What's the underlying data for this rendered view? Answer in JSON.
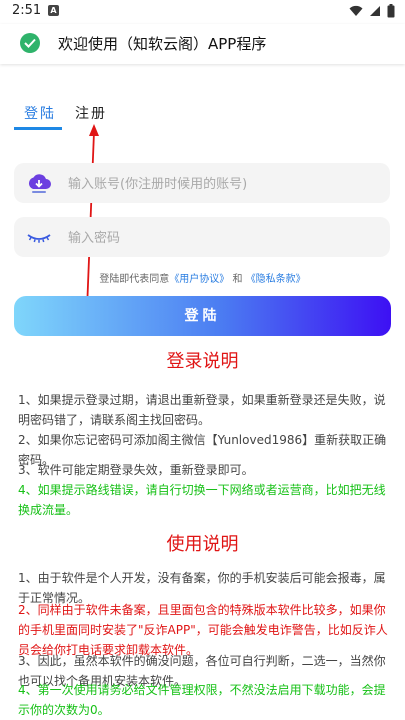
{
  "status_bar": {
    "time": "2:51",
    "notif_icon": "A"
  },
  "banner": {
    "title": "欢迎使用（知软云阁）APP程序",
    "icon": "check-circle-icon"
  },
  "tabs": [
    {
      "label": "登陆"
    },
    {
      "label": "注册"
    }
  ],
  "form": {
    "account_placeholder": "输入账号(你注册时候用的账号)",
    "password_placeholder": "输入密码",
    "agree_prefix": "登陆即代表同意",
    "user_agreement": "《用户协议》",
    "agree_and": "和",
    "privacy_policy": "《隐私条款》",
    "login_button": "登陆"
  },
  "login_notes": {
    "title": "登录说明",
    "items": [
      "1、如果提示登录过期，请退出重新登录，如果重新登录还是失败，说明密码错了，请联系阁主找回密码。",
      "2、如果你忘记密码可添加阁主微信【Yunloved1986】重新获取正确密码。",
      "3、软件可能定期登录失效，重新登录即可。",
      "4、如果提示路线错误，请自行切换一下网络或者运营商，比如把无线换成流量。"
    ]
  },
  "usage_notes": {
    "title": "使用说明",
    "items": [
      "1、由于软件是个人开发，没有备案，你的手机安装后可能会报毒，属于正常情况。",
      "2、同样由于软件未备案，且里面包含的特殊版本软件比较多，如果你的手机里面同时安装了\"反诈APP\"，可能会触发电诈警告，比如反诈人员会给你打电话要求卸载本软件。",
      "3、因此，虽然本软件的确没问题，各位可自行判断，二选一，当然你也可以找个备用机安装本软件。",
      "4、第一次使用请务必给文件管理权限，不然没法启用下载功能，会提示你的次数为0。"
    ]
  },
  "colors": {
    "accent": "#2a7de1",
    "red": "#e01515",
    "green": "#16c016"
  }
}
